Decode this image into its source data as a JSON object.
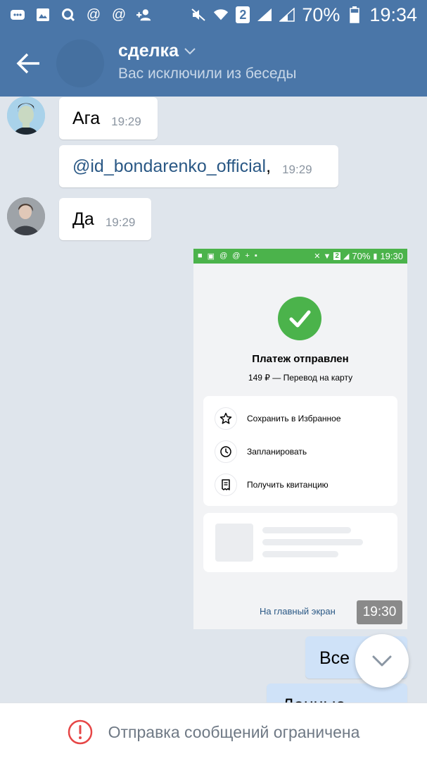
{
  "status_bar": {
    "battery": "70%",
    "time": "19:34",
    "sim": "2",
    "icons": [
      "messages-icon",
      "gallery-icon",
      "search-icon",
      "at-icon",
      "at-icon",
      "add-user-icon",
      "mute-icon",
      "wifi-icon",
      "sim-icon",
      "signal-icon",
      "signal-icon",
      "battery-icon"
    ]
  },
  "header": {
    "title": "сделка",
    "subtitle": "Вас исключили из беседы"
  },
  "messages": [
    {
      "text": "Ага",
      "time": "19:29"
    },
    {
      "mention": "@id_bondarenko_official",
      "suffix": ",",
      "time": "19:29"
    },
    {
      "text": "Да",
      "time": "19:29"
    }
  ],
  "payment_screenshot": {
    "status_bar": {
      "battery": "70%",
      "time": "19:30",
      "sim": "2"
    },
    "title": "Платеж отправлен",
    "subtitle": "149 ₽ — Перевод на карту",
    "options": [
      {
        "label": "Сохранить в Избранное",
        "icon": "star-icon"
      },
      {
        "label": "Запланировать",
        "icon": "clock-icon"
      },
      {
        "label": "Получить квитанцию",
        "icon": "receipt-icon"
      }
    ],
    "home_link": "На главный экран",
    "time": "19:30"
  },
  "own_messages": [
    {
      "text": "Все"
    },
    {
      "text": "Данные"
    }
  ],
  "bottom": {
    "notice": "Отправка сообщений ограничена"
  },
  "colors": {
    "brand": "#4a76a8",
    "chat_bg": "#dfe5ec",
    "own_bubble": "#cfe2f8",
    "success": "#4bb34b",
    "error": "#e64646"
  }
}
